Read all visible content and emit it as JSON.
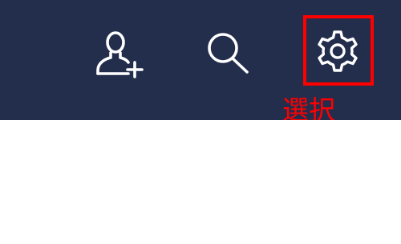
{
  "header": {
    "background_color": "#232d4c",
    "icon_color": "#ffffff",
    "actions": [
      {
        "icon": "add-friend-icon"
      },
      {
        "icon": "search-icon"
      },
      {
        "icon": "settings-icon",
        "highlighted": true
      }
    ]
  },
  "annotation": {
    "label": "選択",
    "color": "#ff0000"
  },
  "content": {
    "background_color": "#ffffff"
  }
}
